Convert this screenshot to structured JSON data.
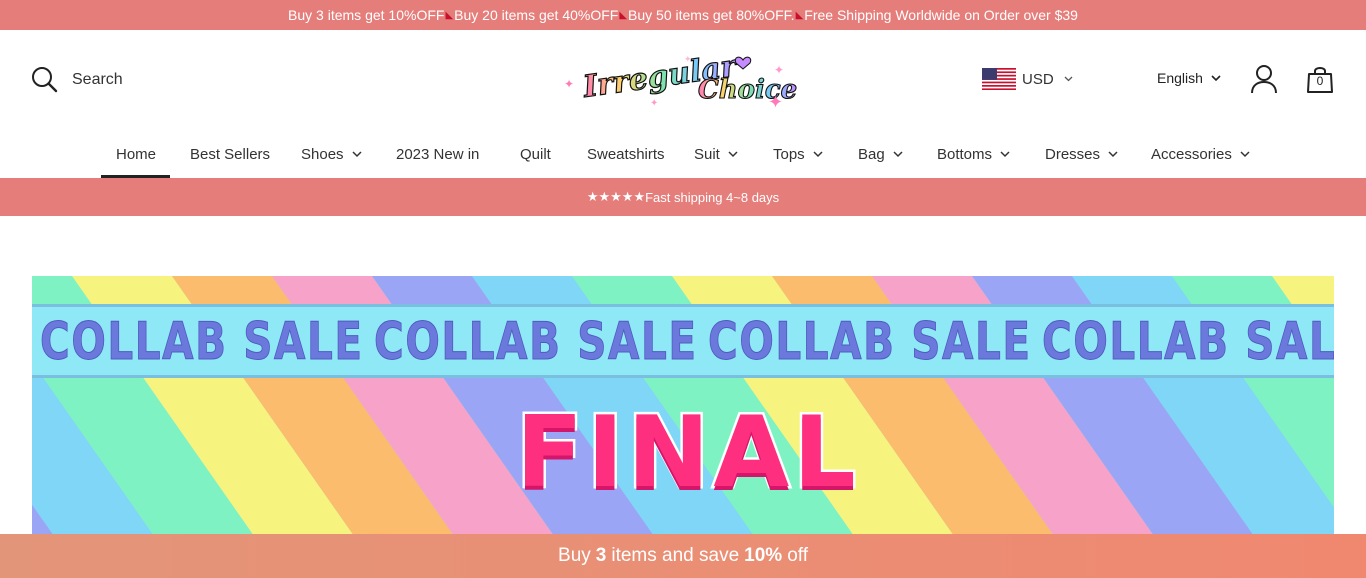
{
  "announcement": {
    "part1": "Buy 3 items get 10%OFF",
    "part2": "Buy 20 items get 40%OFF",
    "part3": "Buy 50 items get 80%OFF.",
    "part4": "Free Shipping Worldwide on Order over $39",
    "separator_icon": "high-heel-shoe-icon",
    "separator_color": "#c8102e"
  },
  "header": {
    "search_label": "Search",
    "logo_text": "Irregular Choice",
    "currency": "USD",
    "currency_flag": "us-flag-icon",
    "language": "English",
    "cart_count": "0"
  },
  "nav": {
    "items": [
      {
        "label": "Home",
        "dropdown": false,
        "active": true
      },
      {
        "label": "Best Sellers",
        "dropdown": false
      },
      {
        "label": "Shoes",
        "dropdown": true
      },
      {
        "label": "2023 New in",
        "dropdown": false
      },
      {
        "label": "Quilt",
        "dropdown": false
      },
      {
        "label": "Sweatshirts",
        "dropdown": false
      },
      {
        "label": "Suit",
        "dropdown": true
      },
      {
        "label": "Tops",
        "dropdown": true
      },
      {
        "label": "Bag",
        "dropdown": true
      },
      {
        "label": "Bottoms",
        "dropdown": true
      },
      {
        "label": "Dresses",
        "dropdown": true
      },
      {
        "label": "Accessories",
        "dropdown": true
      }
    ]
  },
  "shipping_bar": {
    "stars": "★★★★★",
    "text": "Fast shipping 4~8 days"
  },
  "banner": {
    "collab_text": "COLLAB SALE",
    "headline": "FINAL"
  },
  "promo_bar": {
    "prefix": "Buy",
    "quantity": "3",
    "middle": "items and save",
    "discount": "10%",
    "suffix": "off"
  },
  "colors": {
    "accent_bar": "#e57d7a",
    "headline_pink": "#ff2f80",
    "collab_blue": "#6b79dc"
  }
}
